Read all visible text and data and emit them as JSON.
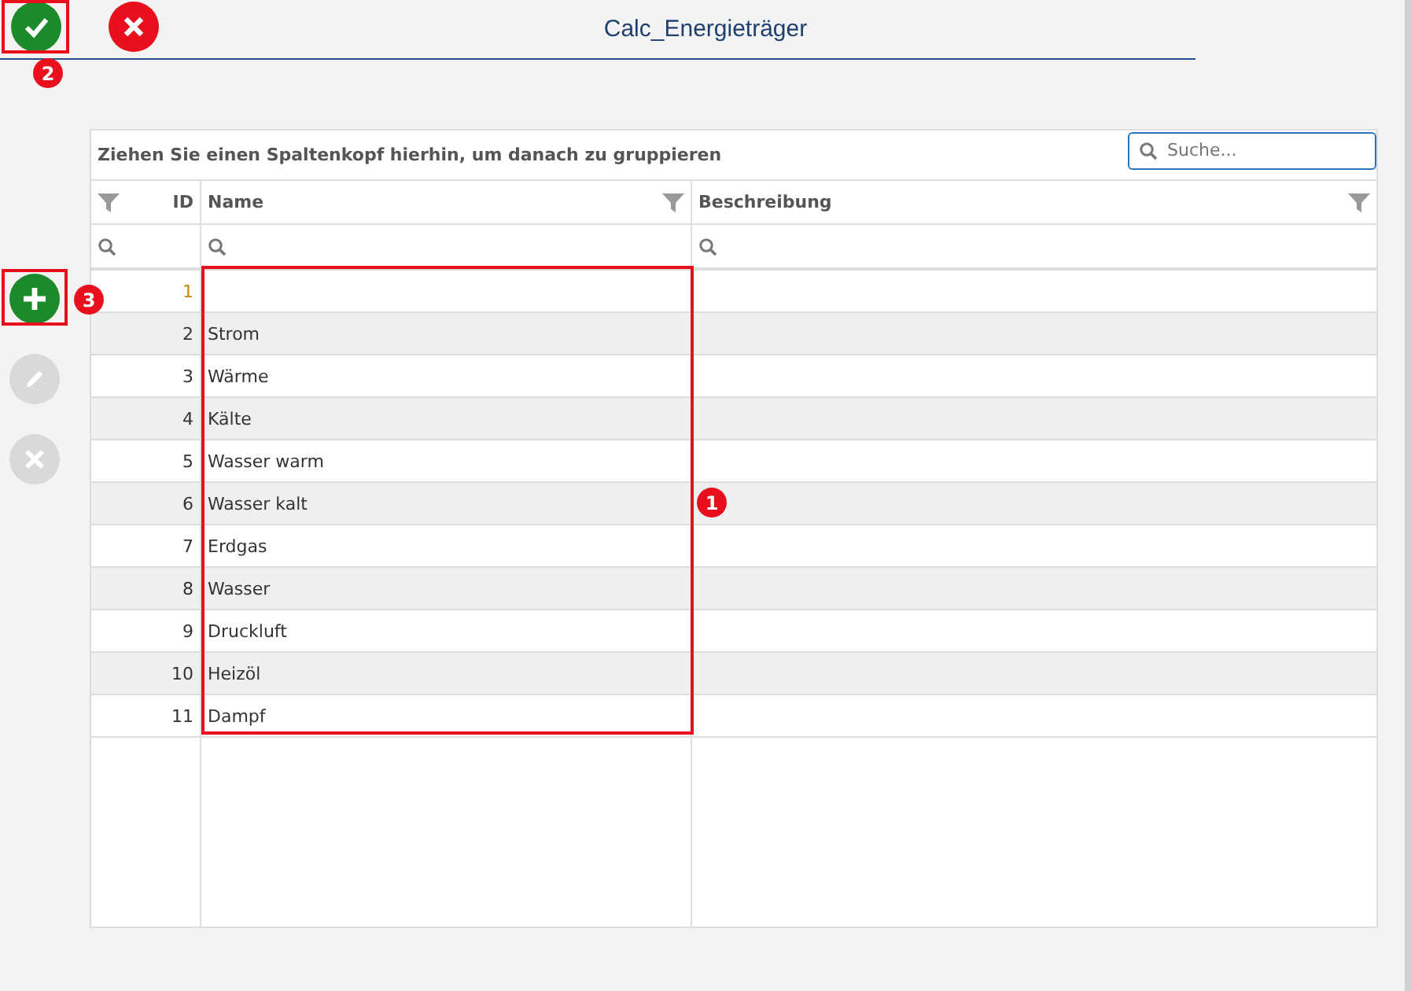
{
  "window": {
    "title": "Calc_Energieträger"
  },
  "top_actions": [
    {
      "kind": "confirm",
      "disabled": false
    },
    {
      "kind": "cancel",
      "disabled": false
    }
  ],
  "side_actions": [
    {
      "kind": "add",
      "disabled": false
    },
    {
      "kind": "edit",
      "disabled": true
    },
    {
      "kind": "delete",
      "disabled": true
    }
  ],
  "grid": {
    "group_hint": "Ziehen Sie einen Spaltenkopf hierhin, um danach zu gruppieren",
    "search": {
      "placeholder": "Suche..."
    },
    "columns": [
      "ID",
      "Name",
      "Beschreibung"
    ],
    "rows": [
      {
        "id": "1",
        "name": "",
        "new": true
      },
      {
        "id": "2",
        "name": "Strom",
        "new": false
      },
      {
        "id": "3",
        "name": "Wärme",
        "new": false
      },
      {
        "id": "4",
        "name": "Kälte",
        "new": false
      },
      {
        "id": "5",
        "name": "Wasser warm",
        "new": false
      },
      {
        "id": "6",
        "name": "Wasser kalt",
        "new": false
      },
      {
        "id": "7",
        "name": "Erdgas",
        "new": false
      },
      {
        "id": "8",
        "name": "Wasser",
        "new": false
      },
      {
        "id": "9",
        "name": "Druckluft",
        "new": false
      },
      {
        "id": "10",
        "name": "Heizöl",
        "new": false
      },
      {
        "id": "11",
        "name": "Dampf",
        "new": false
      }
    ]
  },
  "annotations": [
    {
      "number": "1",
      "kind": "column"
    },
    {
      "number": "2",
      "kind": "top"
    },
    {
      "number": "3",
      "kind": "side"
    }
  ]
}
